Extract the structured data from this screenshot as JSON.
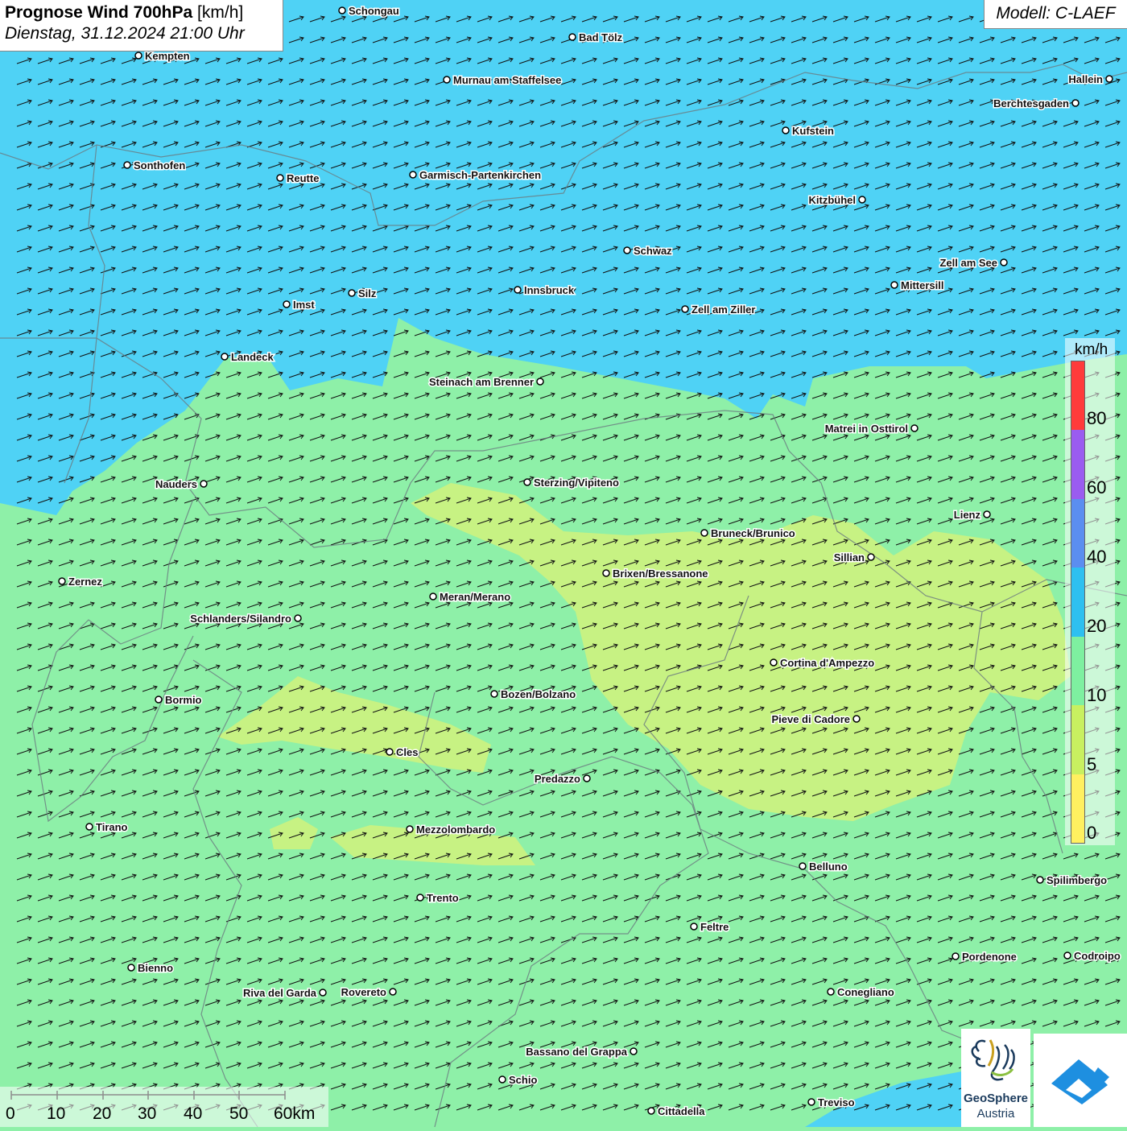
{
  "header": {
    "title_bold": "Prognose Wind 700hPa",
    "title_unit": " [km/h]",
    "datetime": "Dienstag, 31.12.2024 21:00 Uhr",
    "model": "Modell: C-LAEF"
  },
  "legend": {
    "unit": "km/h",
    "labels": [
      "80",
      "60",
      "40",
      "20",
      "10",
      "5",
      "0"
    ],
    "colors": [
      "#ff3b3b",
      "#9a5cf0",
      "#5b8ef0",
      "#2ec0f0",
      "#7ef0a0",
      "#c8f060",
      "#fff060"
    ]
  },
  "scale_bar": {
    "labels": [
      "0",
      "10",
      "20",
      "30",
      "40",
      "50",
      "60km"
    ]
  },
  "cities": [
    {
      "name": "Schongau"
    },
    {
      "name": "Bad Tölz"
    },
    {
      "name": "Kempten"
    },
    {
      "name": "Murnau am Staffelsee"
    },
    {
      "name": "Hallein"
    },
    {
      "name": "Berchtesgaden"
    },
    {
      "name": "Kufstein"
    },
    {
      "name": "Sonthofen"
    },
    {
      "name": "Reutte"
    },
    {
      "name": "Garmisch-Partenkirchen"
    },
    {
      "name": "Kitzbühel"
    },
    {
      "name": "Schwaz"
    },
    {
      "name": "Zell am See"
    },
    {
      "name": "Mittersill"
    },
    {
      "name": "Innsbruck"
    },
    {
      "name": "Imst"
    },
    {
      "name": "Silz"
    },
    {
      "name": "Zell am Ziller"
    },
    {
      "name": "Landeck"
    },
    {
      "name": "Steinach am Brenner"
    },
    {
      "name": "Matrei in Osttirol"
    },
    {
      "name": "Nauders"
    },
    {
      "name": "Sterzing/Vipiteno"
    },
    {
      "name": "Lienz"
    },
    {
      "name": "Bruneck/Brunico"
    },
    {
      "name": "Sillian"
    },
    {
      "name": "Zernez"
    },
    {
      "name": "Brixen/Bressanone"
    },
    {
      "name": "Meran/Merano"
    },
    {
      "name": "Schlanders/Silandro"
    },
    {
      "name": "Cortina d'Ampezzo"
    },
    {
      "name": "Bozen/Bolzano"
    },
    {
      "name": "Bormio"
    },
    {
      "name": "Pieve di Cadore"
    },
    {
      "name": "Cles"
    },
    {
      "name": "Predazzo"
    },
    {
      "name": "Tirano"
    },
    {
      "name": "Mezzolombardo"
    },
    {
      "name": "Belluno"
    },
    {
      "name": "Spilimbergo"
    },
    {
      "name": "Trento"
    },
    {
      "name": "Feltre"
    },
    {
      "name": "Bienno"
    },
    {
      "name": "Pordenone"
    },
    {
      "name": "Codroipo"
    },
    {
      "name": "Riva del Garda"
    },
    {
      "name": "Rovereto"
    },
    {
      "name": "Conegliano"
    },
    {
      "name": "Bassano del Grappa"
    },
    {
      "name": "Schio"
    },
    {
      "name": "Treviso"
    },
    {
      "name": "Cittadella"
    }
  ],
  "logos": {
    "geosphere_line1": "GeoSphere",
    "geosphere_line2": "Austria"
  }
}
